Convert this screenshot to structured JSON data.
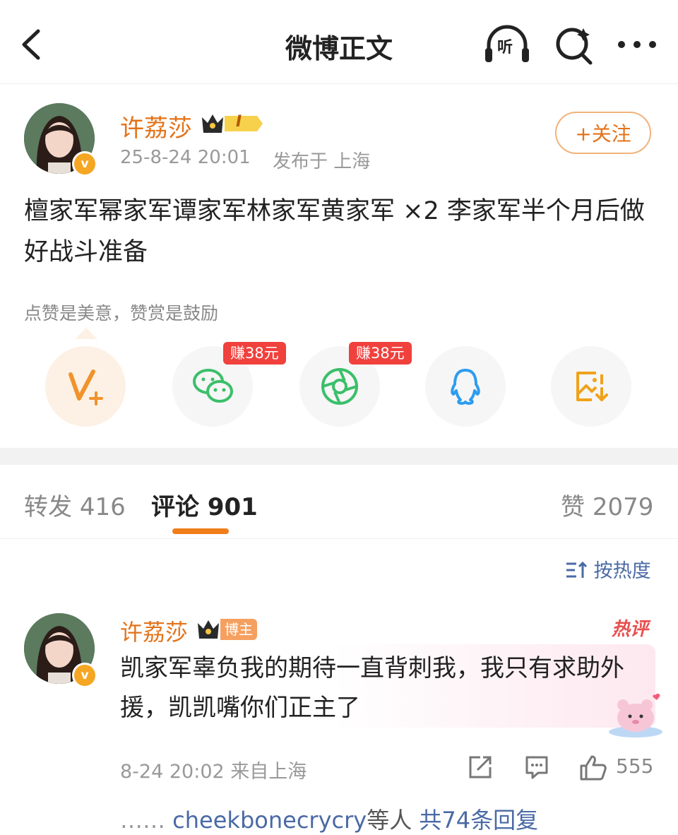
{
  "header": {
    "title": "微博正文",
    "listen_label": "听"
  },
  "post": {
    "author_name": "许荔莎",
    "level_badge": "I",
    "timestamp": "25-8-24 20:01",
    "location": "发布于 上海",
    "follow_label": "+关注",
    "verified_mark": "v",
    "body": "檀家军幂家军谭家军林家军黄家军 ×2 李家军半个月后做好战斗准备",
    "reward_tip": "点赞是美意，赞赏是鼓励"
  },
  "share": {
    "wechat_earn": "赚38元",
    "moments_earn": "赚38元"
  },
  "tabs": [
    {
      "label": "转发",
      "count": "416"
    },
    {
      "label": "评论",
      "count": "901"
    },
    {
      "label": "赞",
      "count": "2079"
    }
  ],
  "sort_label": "按热度",
  "comment": {
    "author_name": "许荔莎",
    "author_tag": "博主",
    "hot_label": "热评",
    "text": "凯家军辜负我的期待一直背刺我，我只有求助外援，凯凯嘴你们正主了",
    "time": "8-24 20:02",
    "location": "来自上海",
    "likes": "555",
    "reply_users": "cheekbonecrycry",
    "reply_suffix": "等人",
    "reply_count": "共74条回复"
  },
  "colors": {
    "accent": "#e3731a",
    "link": "#4a6aa5",
    "earn_badge": "#f0413d"
  }
}
